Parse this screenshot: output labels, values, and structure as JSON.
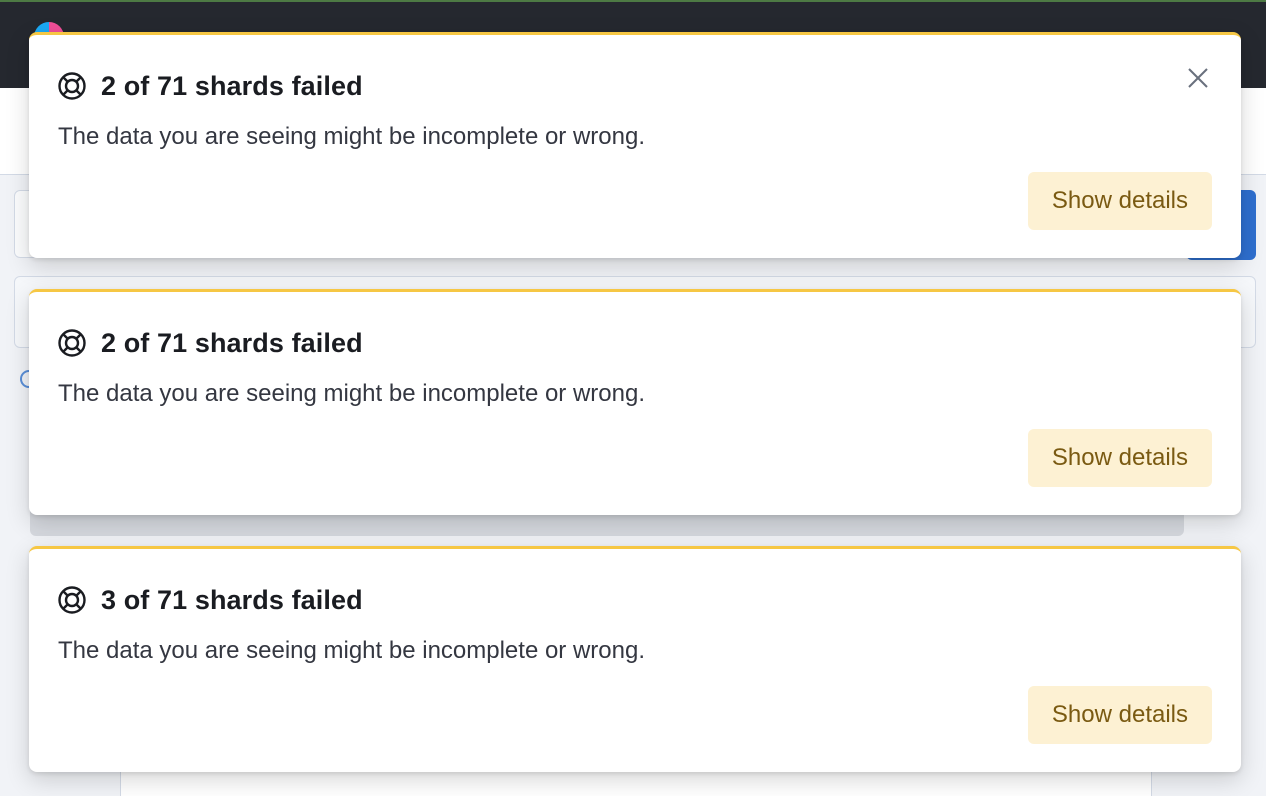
{
  "toasts": [
    {
      "title": "2 of 71 shards failed",
      "message": "The data you are seeing might be incomplete or wrong.",
      "button_label": "Show details",
      "icon": "help-icon",
      "has_close": true
    },
    {
      "title": "2 of 71 shards failed",
      "message": "The data you are seeing might be incomplete or wrong.",
      "button_label": "Show details",
      "icon": "help-icon",
      "has_close": false
    },
    {
      "title": "3 of 71 shards failed",
      "message": "The data you are seeing might be incomplete or wrong.",
      "button_label": "Show details",
      "icon": "help-icon",
      "has_close": false
    }
  ],
  "colors": {
    "warning_accent": "#f6c744",
    "button_bg": "#fdf1d3",
    "button_text": "#7a5a12",
    "header_bg": "#25282f"
  }
}
